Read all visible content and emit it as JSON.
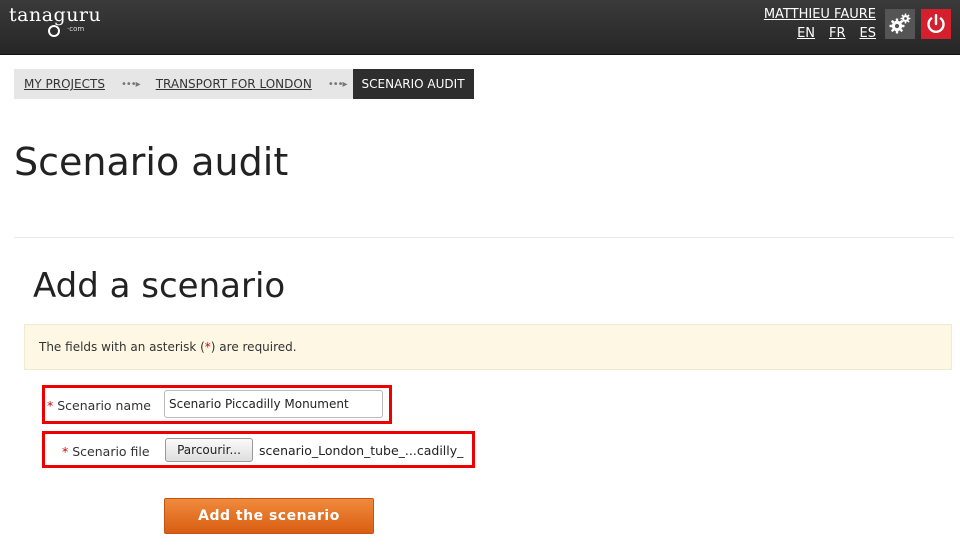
{
  "header": {
    "logo_text": "tanaguru",
    "logo_sub": "·com",
    "user_name": "MATTHIEU FAURE",
    "languages": [
      "EN",
      "FR",
      "ES"
    ],
    "settings_icon": "gears-icon",
    "power_icon": "power-icon",
    "colors": {
      "bar": "#2b2b2b",
      "power": "#d41f2c",
      "settings": "#555555"
    }
  },
  "breadcrumb": {
    "items": [
      "MY PROJECTS",
      "TRANSPORT FOR LONDON"
    ],
    "separator": "•••▸",
    "current": "SCENARIO AUDIT"
  },
  "page_title": "Scenario audit",
  "section_title": "Add a scenario",
  "notice": {
    "before": "The fields with an asterisk (",
    "asterisk": "*",
    "after": ") are required."
  },
  "form": {
    "name_field": {
      "asterisk": "*",
      "label": "Scenario name",
      "value": "Scenario Piccadilly Monument"
    },
    "file_field": {
      "asterisk": "*",
      "label": "Scenario file",
      "browse_label": "Parcourir...",
      "file_name": "scenario_London_tube_...cadilly_m"
    },
    "submit_label": "Add the scenario"
  },
  "colors": {
    "accent": "#e06b1f",
    "highlight_border": "#e00000",
    "notice_bg": "#fdf7e3"
  }
}
